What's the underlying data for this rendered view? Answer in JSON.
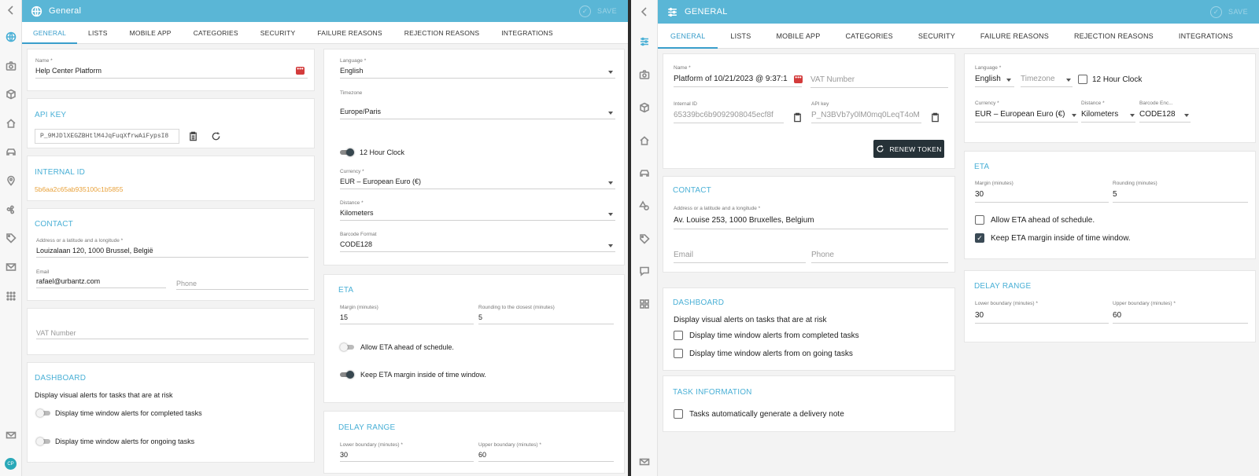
{
  "left": {
    "header": {
      "title": "General",
      "save_label": "SAVE"
    },
    "tabs": [
      "GENERAL",
      "LISTS",
      "MOBILE APP",
      "CATEGORIES",
      "SECURITY",
      "FAILURE REASONS",
      "REJECTION REASONS",
      "INTEGRATIONS"
    ],
    "sidebar": {
      "avatar": "CP"
    },
    "name": {
      "label": "Name *",
      "value": "Help Center Platform"
    },
    "api_key": {
      "title": "API KEY",
      "value": "P_9MJDlXEGZBHtlM4JqFuqXfrwAiFypsI8"
    },
    "internal_id": {
      "title": "INTERNAL ID",
      "value": "5b6aa2c65ab935100c1b5855"
    },
    "contact": {
      "title": "CONTACT",
      "address_label": "Address or a latitude and a longitude *",
      "address_value": "Louizalaan 120, 1000 Brussel, België",
      "email_label": "Email",
      "email_value": "rafael@urbantz.com",
      "phone_placeholder": "Phone"
    },
    "vat_placeholder": "VAT Number",
    "dashboard": {
      "title": "DASHBOARD",
      "desc": "Display visual alerts for tasks that are at risk",
      "opt1": "Display time window alerts for completed tasks",
      "opt2": "Display time window alerts for ongoing tasks"
    },
    "settings": {
      "language_label": "Language *",
      "language_value": "English",
      "timezone_label": "Timezone",
      "timezone_value": "Europe/Paris",
      "clock_label": "12 Hour Clock",
      "currency_label": "Currency *",
      "currency_value": "EUR – European Euro (€)",
      "distance_label": "Distance *",
      "distance_value": "Kilometers",
      "barcode_label": "Barcode Format",
      "barcode_value": "CODE128"
    },
    "eta": {
      "title": "ETA",
      "margin_label": "Margin (minutes)",
      "margin_value": "15",
      "rounding_label": "Rounding to the closest (minutes)",
      "rounding_value": "5",
      "ahead_label": "Allow ETA ahead of schedule.",
      "keep_label": "Keep ETA margin inside of time window."
    },
    "delay": {
      "title": "DELAY RANGE",
      "lower_label": "Lower boundary (minutes) *",
      "lower_value": "30",
      "upper_label": "Upper boundary (minutes) *",
      "upper_value": "60"
    }
  },
  "right": {
    "header": {
      "title": "GENERAL",
      "save_label": "SAVE"
    },
    "tabs": [
      "GENERAL",
      "LISTS",
      "MOBILE APP",
      "CATEGORIES",
      "SECURITY",
      "FAILURE REASONS",
      "REJECTION REASONS",
      "INTEGRATIONS"
    ],
    "name": {
      "label": "Name *",
      "value": "Platform of 10/21/2023 @ 9:37:1",
      "vat_placeholder": "VAT Number"
    },
    "internal_id": {
      "label": "Internal ID",
      "value": "65339bc6b9092908045ecf8f"
    },
    "api_key": {
      "label": "API key",
      "value": "P_N3BVb7y0lM0mq0LeqT4oM"
    },
    "renew_label": "RENEW TOKEN",
    "contact": {
      "title": "CONTACT",
      "address_label": "Address or a latitude and a longitude *",
      "address_value": "Av. Louise 253, 1000 Bruxelles, Belgium",
      "email_placeholder": "Email",
      "phone_placeholder": "Phone"
    },
    "dashboard": {
      "title": "DASHBOARD",
      "desc": "Display visual alerts on tasks that are at risk",
      "opt1": "Display time window alerts from completed tasks",
      "opt2": "Display time window alerts from on going tasks"
    },
    "task_info": {
      "title": "TASK INFORMATION",
      "opt1": "Tasks automatically generate a delivery note"
    },
    "settings": {
      "language_label": "Language *",
      "language_value": "English",
      "timezone_placeholder": "Timezone",
      "clock_label": "12 Hour Clock",
      "currency_label": "Currency *",
      "currency_value": "EUR – European Euro (€)",
      "distance_label": "Distance *",
      "distance_value": "Kilometers",
      "barcode_label": "Barcode Enc...",
      "barcode_value": "CODE128"
    },
    "eta": {
      "title": "ETA",
      "margin_label": "Margin (minutes)",
      "margin_value": "30",
      "rounding_label": "Rounding (minutes)",
      "rounding_value": "5",
      "ahead_label": "Allow ETA ahead of schedule.",
      "keep_label": "Keep ETA margin inside of time window."
    },
    "delay": {
      "title": "DELAY RANGE",
      "lower_label": "Lower boundary (minutes) *",
      "lower_value": "30",
      "upper_label": "Upper boundary (minutes) *",
      "upper_value": "60"
    }
  }
}
